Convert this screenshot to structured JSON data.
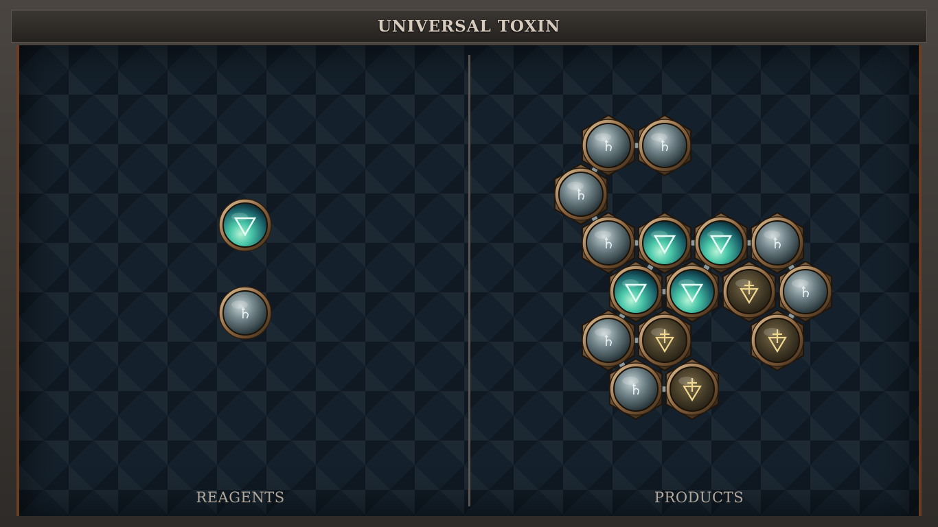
{
  "title": "UNIVERSAL TOXIN",
  "panels": {
    "reagents_label": "REAGENTS",
    "products_label": "PRODUCTS"
  },
  "element_types": {
    "salt": {
      "glyph": "▽",
      "color": "#46c9b0"
    },
    "lead": {
      "glyph": "♄",
      "color": "#8fa3a8"
    },
    "poison": {
      "glyph": "⊤",
      "color": "#6b5a3a"
    }
  },
  "reagents": [
    {
      "name": "salt-reagent",
      "element": "salt"
    },
    {
      "name": "lead-reagent",
      "element": "lead"
    }
  ],
  "product": {
    "atoms": [
      {
        "id": 0,
        "element": "lead"
      },
      {
        "id": 1,
        "element": "lead"
      },
      {
        "id": 2,
        "element": "lead"
      },
      {
        "id": 3,
        "element": "lead"
      },
      {
        "id": 4,
        "element": "salt"
      },
      {
        "id": 5,
        "element": "salt"
      },
      {
        "id": 6,
        "element": "lead"
      },
      {
        "id": 7,
        "element": "salt"
      },
      {
        "id": 8,
        "element": "salt"
      },
      {
        "id": 9,
        "element": "poison"
      },
      {
        "id": 10,
        "element": "lead"
      },
      {
        "id": 11,
        "element": "lead"
      },
      {
        "id": 12,
        "element": "poison"
      },
      {
        "id": 13,
        "element": "poison"
      },
      {
        "id": 14,
        "element": "lead"
      },
      {
        "id": 15,
        "element": "poison"
      }
    ],
    "bonds": [
      [
        0,
        1
      ],
      [
        0,
        2
      ],
      [
        2,
        3
      ],
      [
        3,
        4
      ],
      [
        4,
        5
      ],
      [
        5,
        6
      ],
      [
        4,
        7
      ],
      [
        7,
        8
      ],
      [
        5,
        8
      ],
      [
        6,
        10
      ],
      [
        7,
        11
      ],
      [
        11,
        12
      ],
      [
        11,
        14
      ],
      [
        14,
        15
      ],
      [
        10,
        13
      ]
    ]
  }
}
